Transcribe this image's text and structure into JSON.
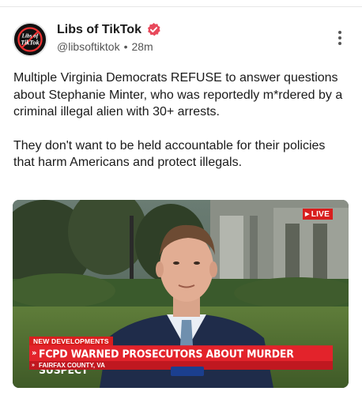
{
  "post": {
    "author": {
      "display_name": "Libs of TikTok",
      "handle": "@libsoftiktok",
      "separator": "•",
      "time_ago": "28m",
      "avatar_text": [
        "Libs of",
        "TikTok"
      ],
      "verified_color": "#e8495b"
    },
    "body": {
      "paragraph_1": "Multiple Virginia Democrats REFUSE to answer questions about Stephanie Minter, who was reportedly m*rdered by a criminal illegal alien with 30+ arrests.",
      "paragraph_2": "They don't want to be held accountable for their policies that harm Americans and protect illegals."
    },
    "media": {
      "live_label": "LIVE",
      "chyron_top": "NEW DEVELOPMENTS",
      "chyron_headline": "FCPD WARNED PROSECUTORS ABOUT MURDER SUSPECT",
      "chyron_location": "FAIRFAX COUNTY, VA",
      "accent_red": "#e3232b"
    }
  }
}
